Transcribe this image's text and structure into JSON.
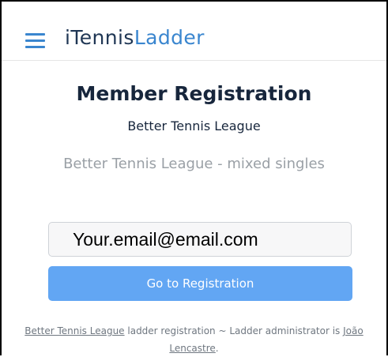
{
  "header": {
    "brand_part1": "iTennis",
    "brand_part2": "Ladder",
    "menu_icon": "hamburger-menu-icon"
  },
  "main": {
    "title": "Member Registration",
    "subtitle": "Better Tennis League",
    "description": "Better Tennis League - mixed singles",
    "email_value": "Your.email@email.com",
    "button_label": "Go to Registration"
  },
  "footer": {
    "league_link": "Better Tennis League",
    "middle_text": " ladder registration ~ Ladder administrator is ",
    "admin_link": "João Lencastre",
    "end_text": "."
  },
  "colors": {
    "brand_dark": "#1f3654",
    "brand_accent": "#3a86cf",
    "button": "#62a6f3"
  }
}
